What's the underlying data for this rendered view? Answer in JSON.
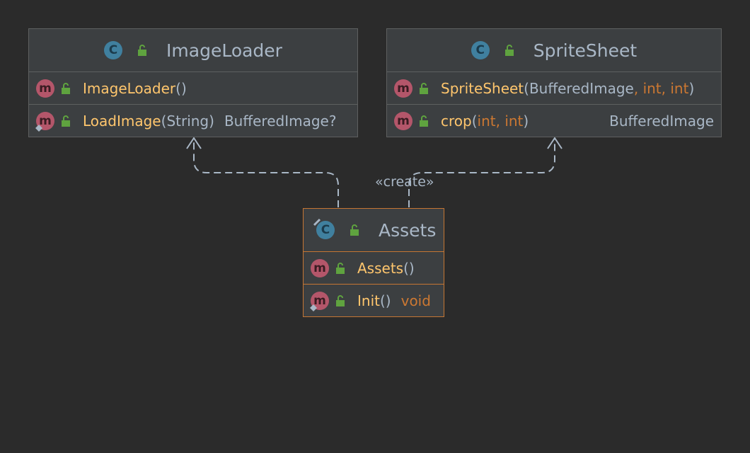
{
  "classes": {
    "image_loader": {
      "name": "ImageLoader",
      "icon": "class-icon",
      "members": [
        {
          "name": "ImageLoader",
          "open": "(",
          "params": "",
          "close": ")",
          "return": ""
        },
        {
          "name": "LoadImage",
          "open": "(",
          "params": "String",
          "close": ")",
          "return": "BufferedImage?"
        }
      ]
    },
    "sprite_sheet": {
      "name": "SpriteSheet",
      "icon": "class-icon",
      "members": [
        {
          "name": "SpriteSheet",
          "open": "(",
          "p1": "BufferedImage",
          "p2": ", int, int",
          "close": ")",
          "return": ""
        },
        {
          "name": "crop",
          "open": "(",
          "p1": "",
          "p2": "int, int",
          "close": ")",
          "return": "BufferedImage"
        }
      ]
    },
    "assets": {
      "name": "Assets",
      "icon": "class-icon",
      "members": [
        {
          "name": "Assets",
          "open": "(",
          "close": ")",
          "return": ""
        },
        {
          "name": "Init",
          "open": "(",
          "close": ")",
          "return": "void"
        }
      ]
    }
  },
  "badges": {
    "class_letter": "C",
    "method_letter": "m"
  },
  "relations": {
    "create_label": "«create»"
  },
  "colors": {
    "background": "#2b2b2b",
    "box": "#3c3f41",
    "selected_border": "#c57633",
    "method_name": "#ffc66d",
    "keyword": "#cc7832",
    "text": "#a9b7c6",
    "class_badge": "#40809f",
    "method_badge": "#b4566a",
    "lock": "#5fa33f"
  }
}
